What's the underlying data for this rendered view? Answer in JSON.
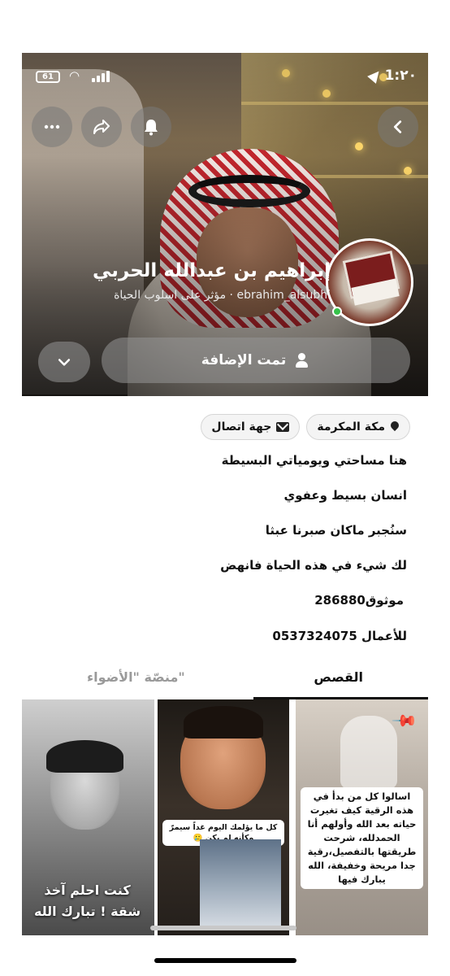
{
  "status_bar": {
    "time": "1:٢٠",
    "battery": "61"
  },
  "header": {
    "back_icon": "chevron-left-icon",
    "bell_icon": "bell-icon",
    "share_icon": "share-arrow-icon",
    "more_icon": "more-horizontal-icon"
  },
  "profile": {
    "name": "إبراهيم بن عبدالله الحربي",
    "subtitle": "ebrahim_alsubhi · مؤثر على اسلوب الحياة",
    "added_label": "تمت الإضافة",
    "online_color": "#36c24a"
  },
  "chips": {
    "location": "مكة المكرمة",
    "contact": "جهة اتصال"
  },
  "bio": [
    "هنا مساحتي ويومياتي البسيطة",
    "انسان بسيط وعفوي",
    "سنُجبر ماكان صبرنا عبثا",
    "لك شيء في هذه الحياة فانهض",
    "موثوق286880",
    "للأعمال 0537324075"
  ],
  "tabs": {
    "stories": "القصص",
    "spotlight": "منصّة \"الأضواء\""
  },
  "stories": [
    {
      "caption": "اسالوا كل من بدأ في هذه الرقية كيف تغيرت حياته بعد الله وأولهم أنا الحمدلله، شرحت طريقتها بالتفصيل،رقية جدا مريحة وخفيفة، الله يبارك فيها"
    },
    {
      "caption": "كل ما يؤلمك اليوم غداً سيمرّ وكأنه لم يكن 🥲"
    },
    {
      "caption": "كنت احلم آخذ شقة ! تبارك الله"
    }
  ]
}
